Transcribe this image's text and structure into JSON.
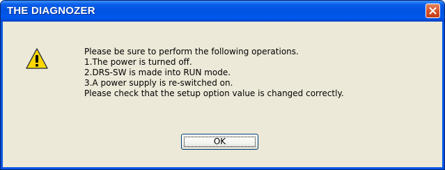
{
  "dialog": {
    "title": "THE DIAGNOZER",
    "icon": "warning-icon",
    "message_lines": [
      "Please be sure to perform the following operations.",
      "1.The power is turned off.",
      "2.DRS-SW is made into RUN mode.",
      "3.A power supply is re-switched on.",
      "Please check that the setup option value is changed correctly."
    ],
    "ok_label": "OK"
  },
  "colors": {
    "titlebar": "#0053e1",
    "close_button": "#d8552b",
    "window_face": "#ece9d8",
    "warning_fill": "#ffe600"
  }
}
